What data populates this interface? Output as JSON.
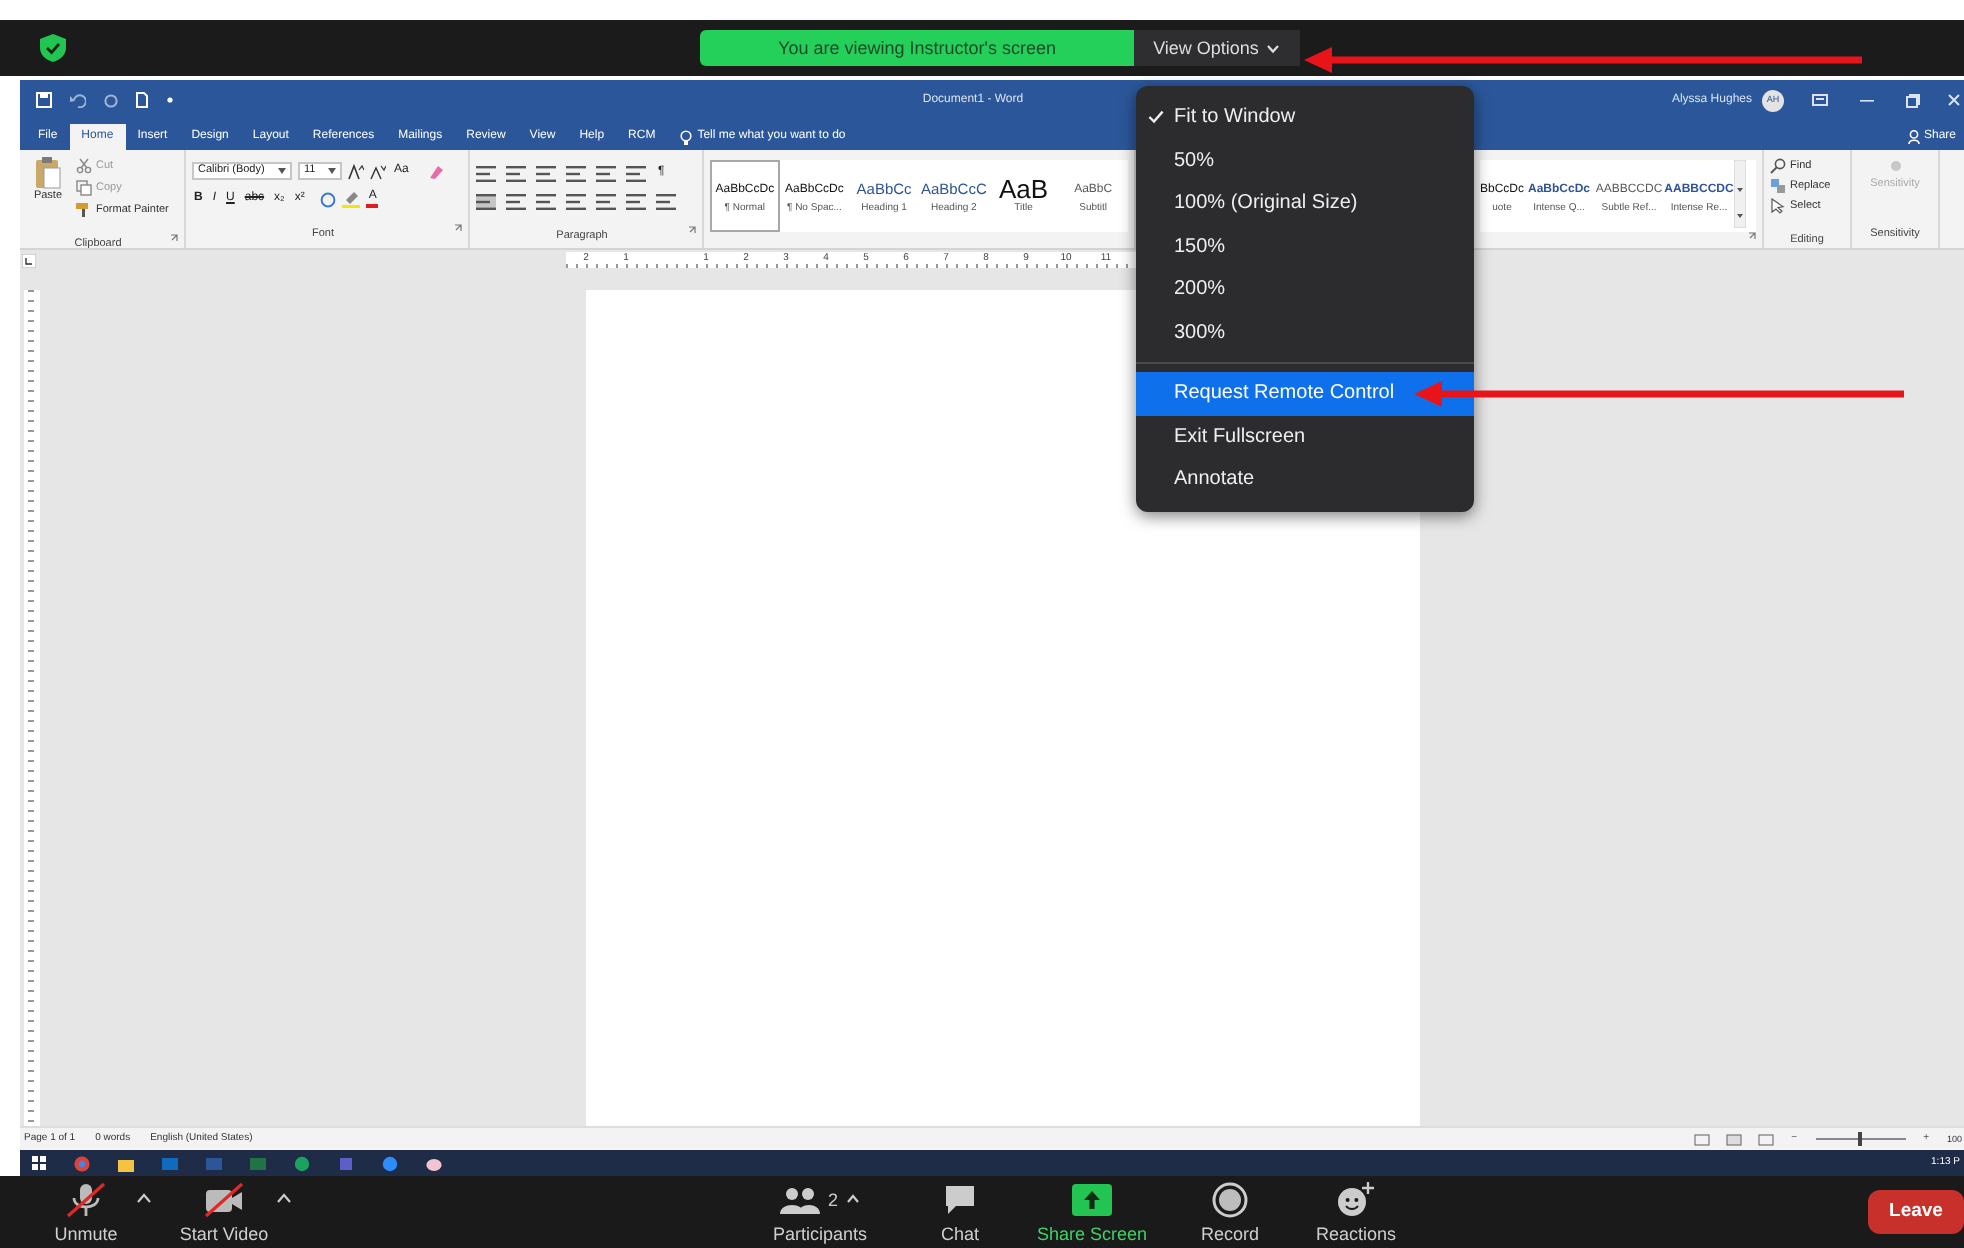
{
  "top_bar": {
    "banner": "You are viewing Instructor's screen",
    "view_options": "View Options"
  },
  "word": {
    "title": "Document1 - Word",
    "user": "Alyssa Hughes",
    "avatar": "AH",
    "tabs": [
      {
        "label": "File",
        "selected": false
      },
      {
        "label": "Home",
        "selected": true
      },
      {
        "label": "Insert",
        "selected": false
      },
      {
        "label": "Design",
        "selected": false
      },
      {
        "label": "Layout",
        "selected": false
      },
      {
        "label": "References",
        "selected": false
      },
      {
        "label": "Mailings",
        "selected": false
      },
      {
        "label": "Review",
        "selected": false
      },
      {
        "label": "View",
        "selected": false
      },
      {
        "label": "Help",
        "selected": false
      },
      {
        "label": "RCM",
        "selected": false
      }
    ],
    "tell_me": "Tell me what you want to do",
    "share": "Share",
    "clipboard": {
      "paste": "Paste",
      "tools": [
        "Cut",
        "Copy",
        "Format Painter"
      ],
      "label": "Clipboard"
    },
    "font": {
      "family": "Calibri (Body)",
      "size": "11",
      "change_case": "Aa",
      "format": [
        "B",
        "I",
        "U",
        "abc",
        "x₂",
        "x²"
      ],
      "color_letter": "A",
      "label": "Font"
    },
    "paragraph": {
      "mark": "¶",
      "label": "Paragraph"
    },
    "styles_left": [
      {
        "preview": "AaBbCcDc",
        "name": "¶ Normal",
        "kind": "body",
        "selected": true
      },
      {
        "preview": "AaBbCcDc",
        "name": "¶ No Spac...",
        "kind": "body",
        "selected": false
      },
      {
        "preview": "AaBbCc",
        "name": "Heading 1",
        "kind": "heading",
        "selected": false
      },
      {
        "preview": "AaBbCcC",
        "name": "Heading 2",
        "kind": "heading",
        "selected": false
      },
      {
        "preview": "AaB",
        "name": "Title",
        "kind": "title",
        "selected": false
      },
      {
        "preview": "AaBbC",
        "name": "Subtitl",
        "kind": "subtle",
        "selected": false
      }
    ],
    "styles_right": [
      {
        "preview": "BbCcDc",
        "name": "uote",
        "kind": "body",
        "selected": false
      },
      {
        "preview": "AaBbCcDc",
        "name": "Intense Q...",
        "kind": "intense",
        "selected": false
      },
      {
        "preview": "AABBCCDC",
        "name": "Subtle Ref...",
        "kind": "subtle",
        "selected": false
      },
      {
        "preview": "AABBCCDC",
        "name": "Intense Re...",
        "kind": "intense",
        "selected": false
      }
    ],
    "editing": {
      "tools": [
        "Find",
        "Replace",
        "Select"
      ],
      "label": "Editing"
    },
    "sensitivity": {
      "button": "Sensitivity",
      "label": "Sensitivity"
    },
    "ruler": [
      "2",
      "1",
      "1",
      "2",
      "3",
      "4",
      "5",
      "6",
      "7",
      "8",
      "9",
      "10",
      "11"
    ],
    "status_bar": {
      "items": [
        "Page 1 of 1",
        "0 words",
        "English (United States)"
      ],
      "zoom_out": "−",
      "zoom_in": "+",
      "level": 0.5,
      "zoom": "100"
    }
  },
  "taskbar": {
    "time": "1:13 P"
  },
  "toolbar": {
    "controls": [
      {
        "label": "Unmute",
        "kind": "mic",
        "off": true,
        "caret": true,
        "active": false
      },
      {
        "label": "Start Video",
        "kind": "camera",
        "off": true,
        "caret": true,
        "active": false
      },
      {
        "label": "Participants",
        "kind": "participants",
        "count": "2",
        "caret": true,
        "active": false
      },
      {
        "label": "Chat",
        "kind": "chat",
        "caret": false,
        "active": false
      },
      {
        "label": "Share Screen",
        "kind": "share",
        "caret": false,
        "active": true
      },
      {
        "label": "Record",
        "kind": "record",
        "caret": false,
        "active": false
      },
      {
        "label": "Reactions",
        "kind": "reactions",
        "caret": false,
        "active": false
      }
    ],
    "leave": "Leave"
  },
  "view_menu": {
    "zoom_levels": [
      {
        "label": "Fit to Window",
        "checked": true
      },
      {
        "label": "50%",
        "checked": false
      },
      {
        "label": "100% (Original Size)",
        "checked": false
      },
      {
        "label": "150%",
        "checked": false
      },
      {
        "label": "200%",
        "checked": false
      },
      {
        "label": "300%",
        "checked": false
      }
    ],
    "actions": [
      {
        "label": "Request Remote Control",
        "selected": true
      },
      {
        "label": "Exit Fullscreen",
        "selected": false
      },
      {
        "label": "Annotate",
        "selected": false
      }
    ]
  }
}
